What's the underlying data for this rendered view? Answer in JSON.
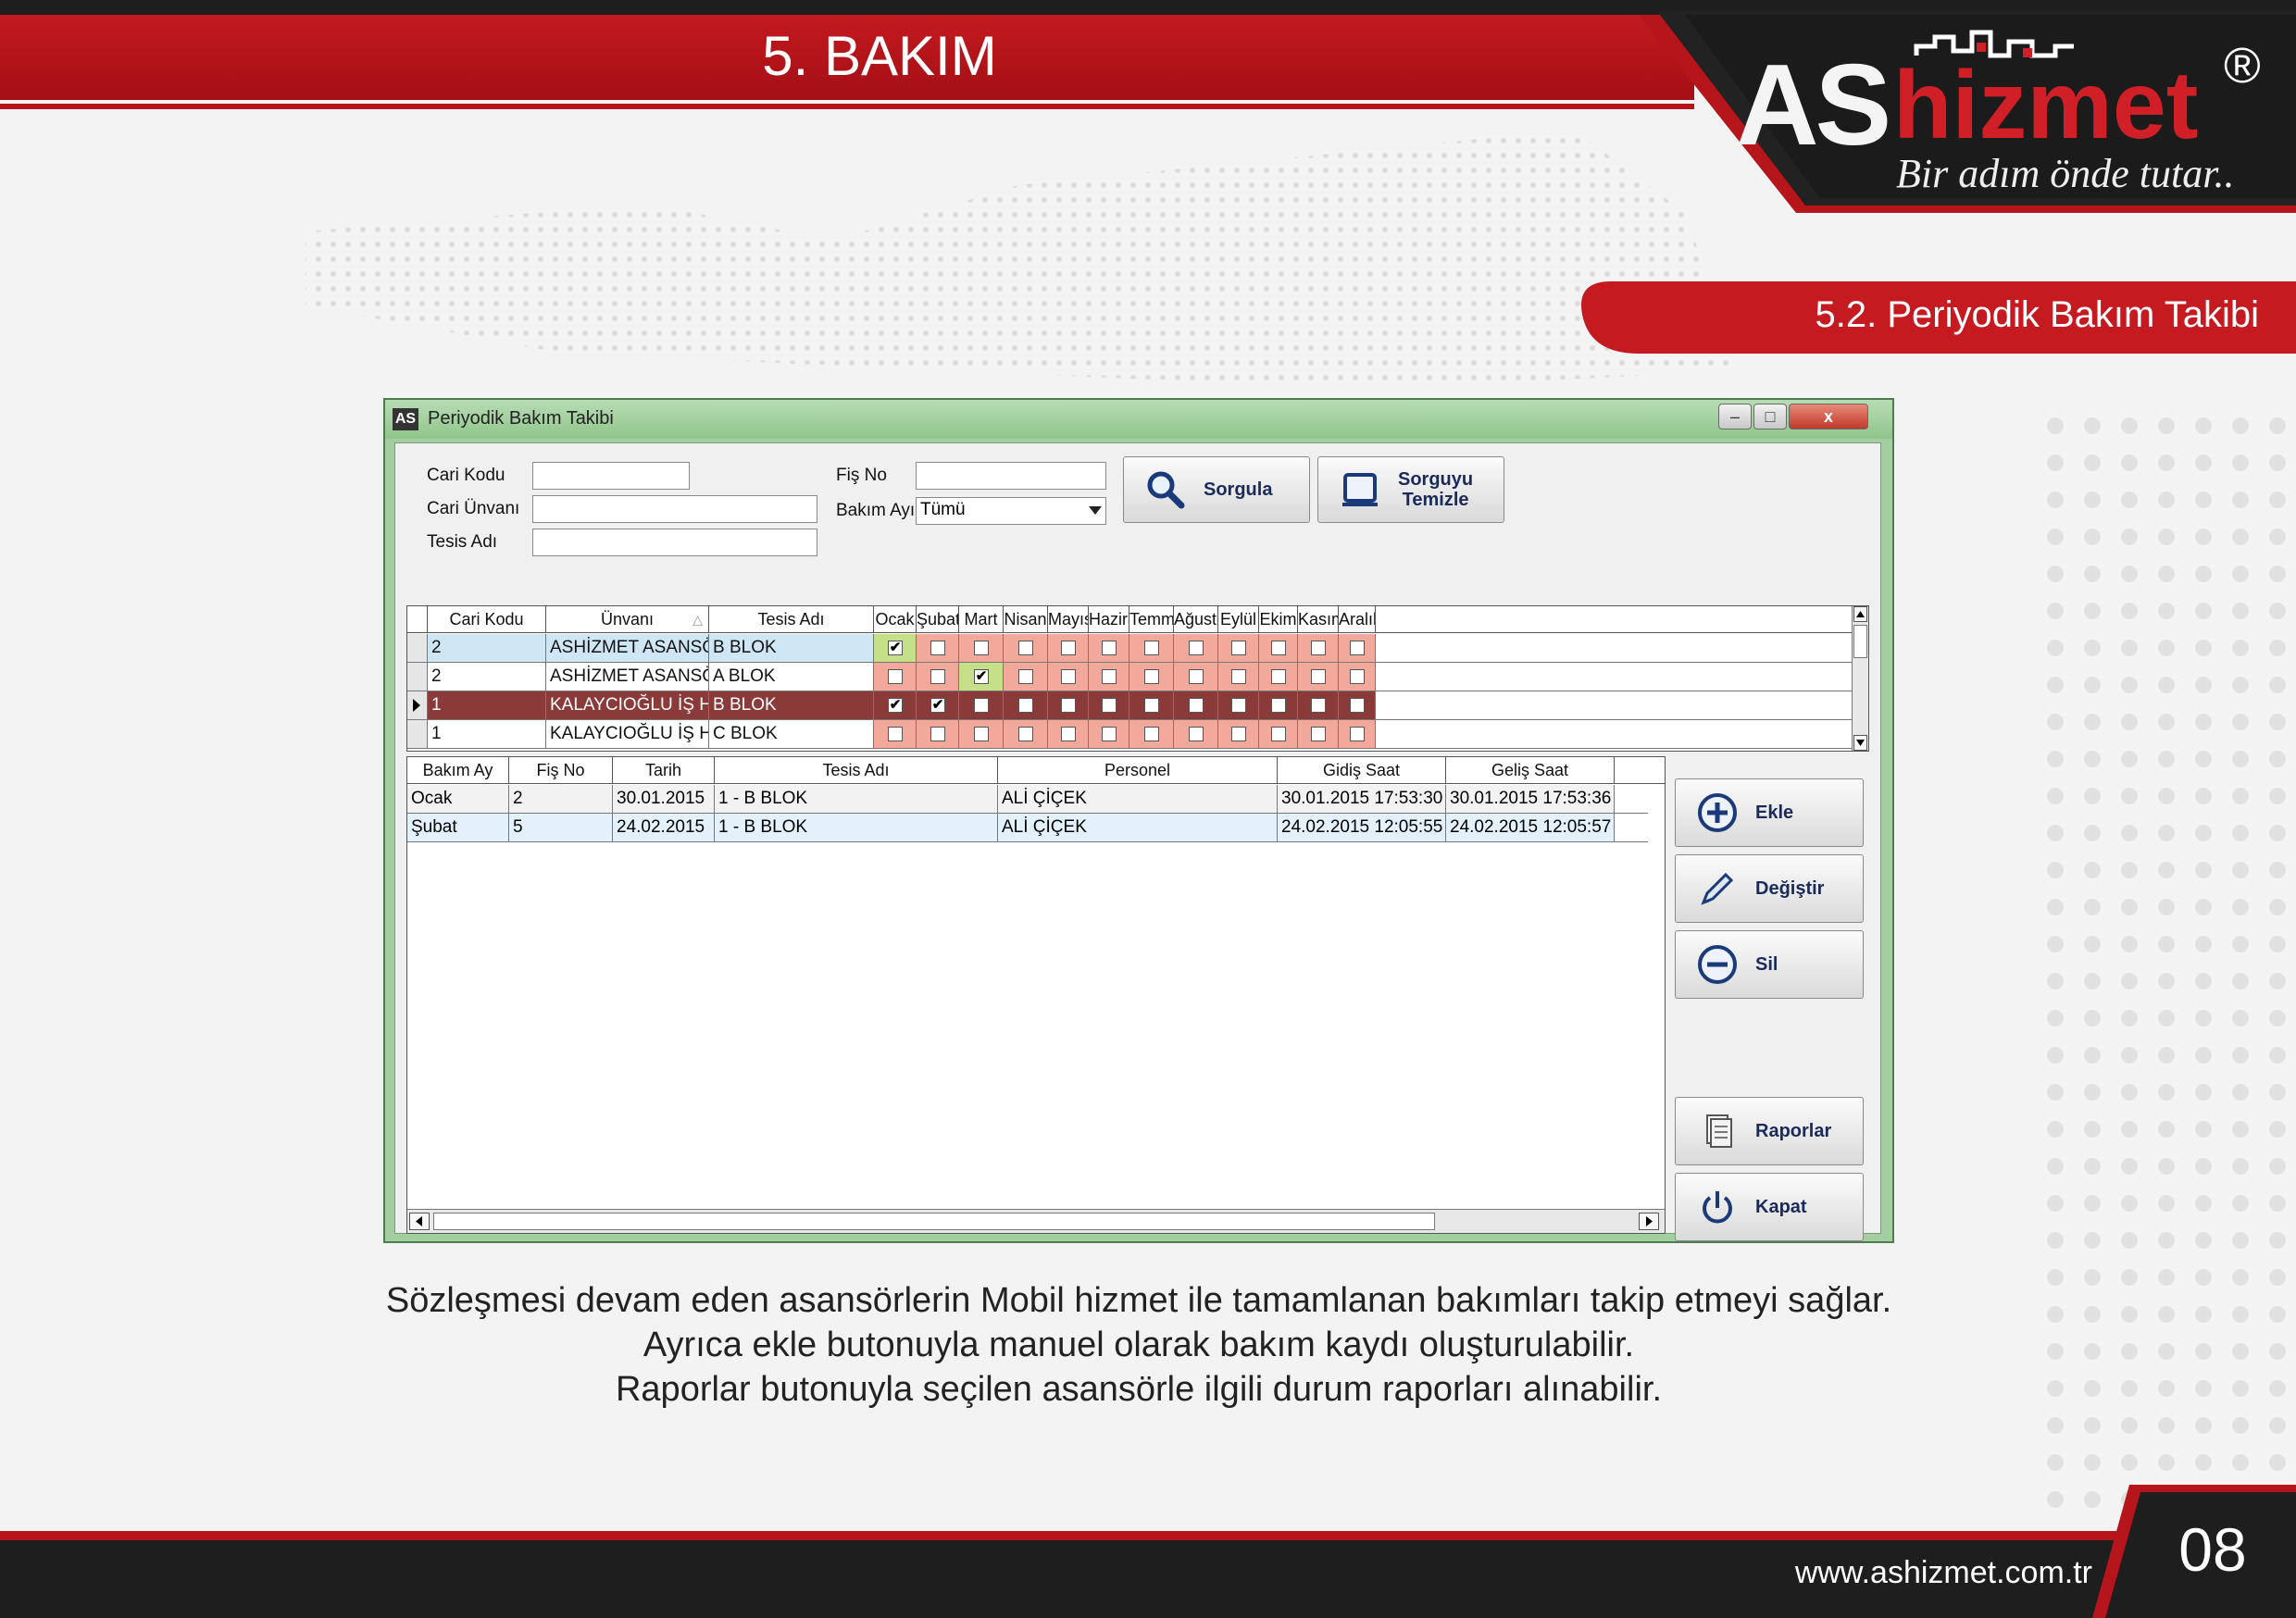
{
  "header": {
    "title": "5. BAKIM",
    "section": "5.2. Periyodik Bakım Takibi"
  },
  "logo": {
    "as": "AS",
    "hizmet": "hizmet",
    "reg": "®",
    "slogan": "Bir adım önde tutar.."
  },
  "window": {
    "icon": "AS",
    "title": "Periyodik Bakım Takibi",
    "controls": {
      "minimize": "–",
      "maximize": "□",
      "close": "x"
    }
  },
  "form": {
    "cari_kodu_label": "Cari Kodu",
    "cari_kodu_value": "",
    "cari_unvani_label": "Cari Ünvanı",
    "cari_unvani_value": "",
    "tesis_adi_label": "Tesis Adı",
    "tesis_adi_value": "",
    "fis_no_label": "Fiş No",
    "fis_no_value": "",
    "bakim_ayi_label": "Bakım Ayı",
    "bakim_ayi_value": "Tümü"
  },
  "toolbar": {
    "sorgula": "Sorgula",
    "temizle_1": "Sorguyu",
    "temizle_2": "Temizle"
  },
  "grid1": {
    "columns": [
      "Cari Kodu",
      "Ünvanı",
      "Tesis Adı",
      "Ocak",
      "Şubat",
      "Mart",
      "Nisan",
      "Mayıs",
      "Haziran",
      "Temmuz",
      "Ağustos",
      "Eylül",
      "Ekim",
      "Kasım",
      "Aralık"
    ],
    "sort_icon": "sort-ascending-icon",
    "rows": [
      {
        "cari_kodu": "2",
        "unvani": "ASHİZMET ASANSÖR",
        "tesis_adi": "B BLOK",
        "months": [
          true,
          false,
          false,
          false,
          false,
          false,
          false,
          false,
          false,
          false,
          false,
          false
        ],
        "selected": false
      },
      {
        "cari_kodu": "2",
        "unvani": "ASHİZMET ASANSÖR",
        "tesis_adi": "A BLOK",
        "months": [
          false,
          false,
          true,
          false,
          false,
          false,
          false,
          false,
          false,
          false,
          false,
          false
        ],
        "selected": false
      },
      {
        "cari_kodu": "1",
        "unvani": "KALAYCIOĞLU İŞ HANI",
        "tesis_adi": "B BLOK",
        "months": [
          true,
          true,
          false,
          false,
          false,
          false,
          false,
          false,
          false,
          false,
          false,
          false
        ],
        "selected": true
      },
      {
        "cari_kodu": "1",
        "unvani": "KALAYCIOĞLU İŞ HANI",
        "tesis_adi": "C BLOK",
        "months": [
          false,
          false,
          false,
          false,
          false,
          false,
          false,
          false,
          false,
          false,
          false,
          false
        ],
        "selected": false
      }
    ]
  },
  "grid2": {
    "columns": [
      "Bakım Ay",
      "Fiş No",
      "Tarih",
      "Tesis Adı",
      "Personel",
      "Gidiş Saat",
      "Geliş Saat"
    ],
    "rows": [
      [
        "Ocak",
        "2",
        "30.01.2015",
        "1 - B BLOK",
        "ALİ ÇİÇEK",
        "30.01.2015 17:53:30",
        "30.01.2015 17:53:36"
      ],
      [
        "Şubat",
        "5",
        "24.02.2015",
        "1 - B BLOK",
        "ALİ ÇİÇEK",
        "24.02.2015 12:05:55",
        "24.02.2015 12:05:57"
      ]
    ]
  },
  "side_buttons": {
    "ekle": "Ekle",
    "degistir": "Değiştir",
    "sil": "Sil",
    "raporlar": "Raporlar",
    "kapat": "Kapat"
  },
  "description": [
    "Sözleşmesi devam eden asansörlerin Mobil hizmet ile tamamlanan bakımları takip etmeyi sağlar.",
    "Ayrıca ekle butonuyla manuel olarak bakım kaydı oluşturulabilir.",
    "Raporlar butonuyla seçilen asansörle ilgili durum raporları alınabilir."
  ],
  "footer": {
    "url": "www.ashizmet.com.tr",
    "page": "08"
  },
  "colors": {
    "brand_red": "#c41a20",
    "dark": "#1e1e1e",
    "month_done": "#c6e08a",
    "month_pending": "#f2a89a",
    "selected_row": "#8b3a3a",
    "row_alt": "#cfe7f5"
  }
}
